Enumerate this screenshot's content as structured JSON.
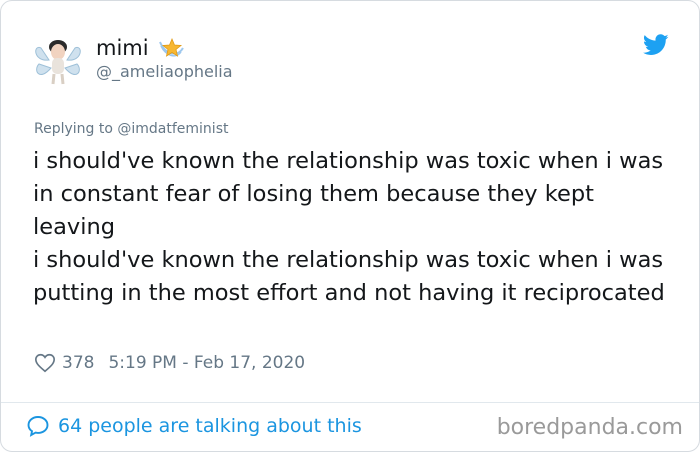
{
  "author": {
    "display_name": "mimi",
    "handle": "@_ameliaophelia",
    "name_emoji": "star-emoji",
    "avatar": "avatar"
  },
  "reply_context": "Replying to @imdatfeminist",
  "tweet_text": "i should've known the relationship was toxic when i was in constant fear of losing them because they kept leaving\ni should've known the relationship was toxic when i was putting in the most effort and not having it reciprocated",
  "likes": "378",
  "timestamp": "5:19 PM - Feb 17, 2020",
  "conversation_link": "64 people are talking about this",
  "watermark": "boredpanda.com",
  "icons": [
    "twitter-bird-icon",
    "heart-icon",
    "comment-bubble-icon"
  ],
  "colors": {
    "link": "#1b95e0",
    "muted": "#657786",
    "text": "#14171a",
    "twitter_blue": "#1da1f2"
  }
}
